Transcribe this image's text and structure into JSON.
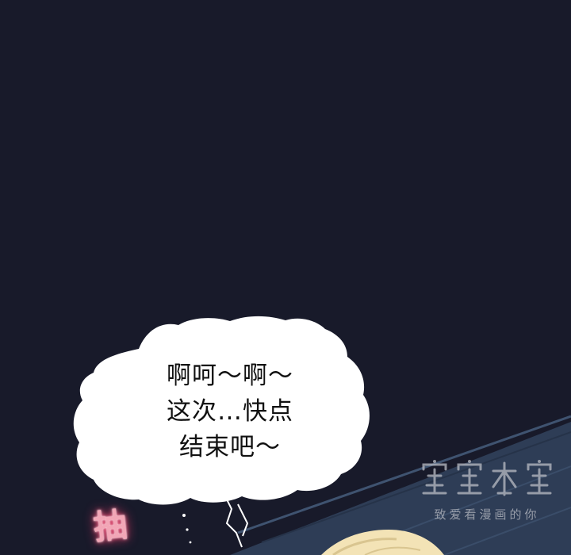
{
  "panel": {
    "background_color": "#181a2a",
    "floor_color": "#2f3e57",
    "bubble_color": "#ffffff"
  },
  "speech_bubble": {
    "lines": [
      "啊呵～啊～",
      "这次…快点",
      "结束吧～"
    ]
  },
  "sound_effect": {
    "text": "抽",
    "color": "#f2a6b6"
  },
  "watermark": {
    "slogan": "致爱看漫画的你"
  }
}
